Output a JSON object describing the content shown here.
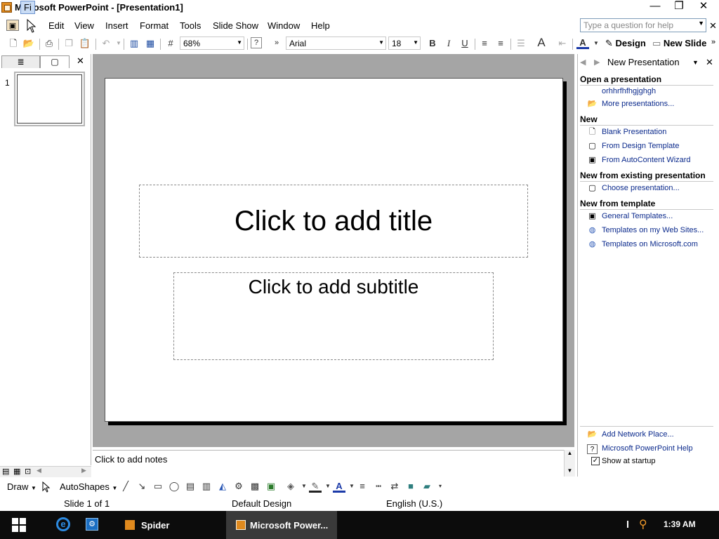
{
  "window": {
    "title": "Microsoft PowerPoint - [Presentation1]",
    "controls": {
      "minimize": "—",
      "restore": "❐",
      "close": "✕"
    }
  },
  "menu": {
    "items": [
      "File",
      "Edit",
      "View",
      "Insert",
      "Format",
      "Tools",
      "Slide Show",
      "Window",
      "Help"
    ],
    "file_visible": "Fi",
    "help_placeholder": "Type a question for help"
  },
  "toolbar": {
    "zoom": "68%",
    "font": "Arial",
    "font_size": "18",
    "design_label": "Design",
    "new_slide_label": "New Slide",
    "bold": "B",
    "italic": "I",
    "underline": "U",
    "font_color": "A"
  },
  "slides_panel": {
    "outline_tab": "≣",
    "slides_tab": "▢",
    "close": "✕",
    "slide_number": "1"
  },
  "slide": {
    "title_placeholder": "Click to add title",
    "subtitle_placeholder": "Click to add subtitle"
  },
  "notes": {
    "placeholder": "Click to add notes"
  },
  "drawing_toolbar": {
    "draw": "Draw",
    "autoshapes": "AutoShapes"
  },
  "status": {
    "slide": "Slide 1 of 1",
    "design": "Default Design",
    "language": "English (U.S.)"
  },
  "task_pane": {
    "title": "New Presentation",
    "sections": {
      "open": "Open a presentation",
      "new": "New",
      "existing": "New from existing presentation",
      "template": "New from template"
    },
    "links": {
      "recent": "orhhrfhfhgjghgh",
      "more": "More presentations...",
      "blank": "Blank Presentation",
      "design_template": "From Design Template",
      "autocontent": "From AutoContent Wizard",
      "choose": "Choose presentation...",
      "general": "General Templates...",
      "web_sites": "Templates on my Web Sites...",
      "microsoft": "Templates on Microsoft.com",
      "network": "Add Network Place...",
      "help": "Microsoft PowerPoint Help",
      "startup": "Show at startup"
    }
  },
  "taskbar": {
    "apps": [
      "Spider",
      "Microsoft Power..."
    ],
    "time": "1:39 AM"
  }
}
